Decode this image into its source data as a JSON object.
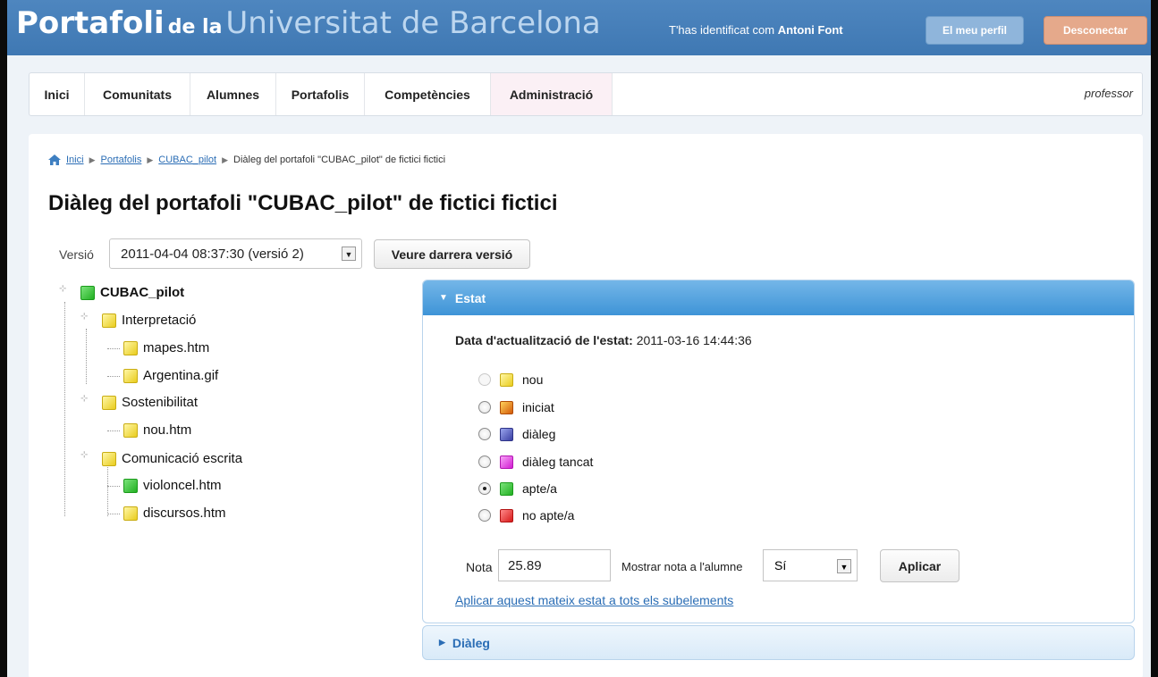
{
  "header": {
    "brand": {
      "part1": "Portafoli",
      "part2": "de la",
      "part3": "Universitat de Barcelona"
    },
    "identity_prefix": "T'has identificat com",
    "identity_user": "Antoni Font",
    "profile_button": "El meu perfil",
    "logout_button": "Desconectar",
    "colors": {
      "header_bg": "#4e86bf",
      "profile_bg": "#8fb5db",
      "logout_bg": "#e5a98b"
    }
  },
  "nav": {
    "items": [
      {
        "label": "Inici"
      },
      {
        "label": "Comunitats"
      },
      {
        "label": "Alumnes"
      },
      {
        "label": "Portafolis"
      },
      {
        "label": "Competències"
      },
      {
        "label": "Administració"
      }
    ],
    "role": "professor"
  },
  "breadcrumb": {
    "items": [
      "Inici",
      "Portafolis",
      "CUBAC_pilot"
    ],
    "current": "Diàleg del portafoli \"CUBAC_pilot\" de fictici fictici"
  },
  "page": {
    "title": "Diàleg del portafoli \"CUBAC_pilot\" de fictici fictici",
    "version_label": "Versió",
    "version_value": "2011-04-04 08:37:30 (versió 2)",
    "latest_button": "Veure darrera versió"
  },
  "tree": {
    "root": "CUBAC_pilot",
    "nodes": [
      {
        "label": "Interpretació"
      },
      {
        "label": "mapes.htm"
      },
      {
        "label": "Argentina.gif"
      },
      {
        "label": "Sostenibilitat"
      },
      {
        "label": "nou.htm"
      },
      {
        "label": "Comunicació escrita"
      },
      {
        "label": "violoncel.htm"
      },
      {
        "label": "discursos.htm"
      }
    ]
  },
  "estat": {
    "header": "Estat",
    "date_label": "Data d'actualització de l'estat:",
    "date_value": "2011-03-16 14:44:36",
    "options": [
      {
        "label": "nou",
        "color": "#e9cc1d"
      },
      {
        "label": "iniciat",
        "color": "#d35a08"
      },
      {
        "label": "diàleg",
        "color": "#3a3fa3"
      },
      {
        "label": "diàleg tancat",
        "color": "#d21cd2"
      },
      {
        "label": "apte/a",
        "color": "#22b022"
      },
      {
        "label": "no apte/a",
        "color": "#d71a1a"
      }
    ],
    "selected": "apte/a",
    "nota_label": "Nota",
    "nota_value": "25.89",
    "mostrar_label": "Mostrar nota a l'alumne",
    "mostrar_value": "Sí",
    "apply_button": "Aplicar",
    "apply_all_link": "Aplicar aquest mateix estat a tots els subelements"
  },
  "dialeg": {
    "header": "Diàleg"
  }
}
